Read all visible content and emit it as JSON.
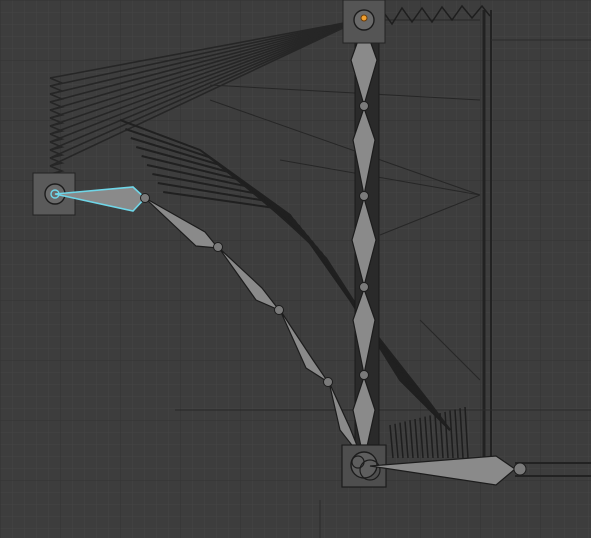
{
  "editor": {
    "type": "3d-viewport",
    "view": "rig-armature-pose",
    "colors": {
      "background": "#3d3d3d",
      "grid_minor": "#444444",
      "grid_major": "#2f2f2f",
      "bone_fill": "#8a8a8a",
      "bone_edge": "#1c1c1c",
      "bone_selected_outline": "#6fd6e8",
      "ghost_mesh": "#2b2b2b",
      "widget_box": "#5a5a5a",
      "active_origin": "#f0a030"
    }
  },
  "armature": {
    "vertical_chain_segments": 4,
    "arm_chain_segments": 4,
    "selected_bone": "upper-arm-bone",
    "foot_bone": "foot-bone"
  }
}
